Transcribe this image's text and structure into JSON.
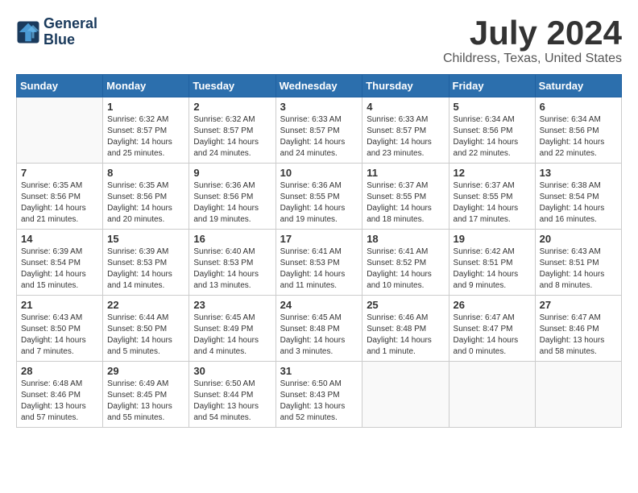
{
  "logo": {
    "line1": "General",
    "line2": "Blue"
  },
  "title": "July 2024",
  "location": "Childress, Texas, United States",
  "weekdays": [
    "Sunday",
    "Monday",
    "Tuesday",
    "Wednesday",
    "Thursday",
    "Friday",
    "Saturday"
  ],
  "weeks": [
    [
      {
        "day": "",
        "sunrise": "",
        "sunset": "",
        "daylight": ""
      },
      {
        "day": "1",
        "sunrise": "Sunrise: 6:32 AM",
        "sunset": "Sunset: 8:57 PM",
        "daylight": "Daylight: 14 hours and 25 minutes."
      },
      {
        "day": "2",
        "sunrise": "Sunrise: 6:32 AM",
        "sunset": "Sunset: 8:57 PM",
        "daylight": "Daylight: 14 hours and 24 minutes."
      },
      {
        "day": "3",
        "sunrise": "Sunrise: 6:33 AM",
        "sunset": "Sunset: 8:57 PM",
        "daylight": "Daylight: 14 hours and 24 minutes."
      },
      {
        "day": "4",
        "sunrise": "Sunrise: 6:33 AM",
        "sunset": "Sunset: 8:57 PM",
        "daylight": "Daylight: 14 hours and 23 minutes."
      },
      {
        "day": "5",
        "sunrise": "Sunrise: 6:34 AM",
        "sunset": "Sunset: 8:56 PM",
        "daylight": "Daylight: 14 hours and 22 minutes."
      },
      {
        "day": "6",
        "sunrise": "Sunrise: 6:34 AM",
        "sunset": "Sunset: 8:56 PM",
        "daylight": "Daylight: 14 hours and 22 minutes."
      }
    ],
    [
      {
        "day": "7",
        "sunrise": "Sunrise: 6:35 AM",
        "sunset": "Sunset: 8:56 PM",
        "daylight": "Daylight: 14 hours and 21 minutes."
      },
      {
        "day": "8",
        "sunrise": "Sunrise: 6:35 AM",
        "sunset": "Sunset: 8:56 PM",
        "daylight": "Daylight: 14 hours and 20 minutes."
      },
      {
        "day": "9",
        "sunrise": "Sunrise: 6:36 AM",
        "sunset": "Sunset: 8:56 PM",
        "daylight": "Daylight: 14 hours and 19 minutes."
      },
      {
        "day": "10",
        "sunrise": "Sunrise: 6:36 AM",
        "sunset": "Sunset: 8:55 PM",
        "daylight": "Daylight: 14 hours and 19 minutes."
      },
      {
        "day": "11",
        "sunrise": "Sunrise: 6:37 AM",
        "sunset": "Sunset: 8:55 PM",
        "daylight": "Daylight: 14 hours and 18 minutes."
      },
      {
        "day": "12",
        "sunrise": "Sunrise: 6:37 AM",
        "sunset": "Sunset: 8:55 PM",
        "daylight": "Daylight: 14 hours and 17 minutes."
      },
      {
        "day": "13",
        "sunrise": "Sunrise: 6:38 AM",
        "sunset": "Sunset: 8:54 PM",
        "daylight": "Daylight: 14 hours and 16 minutes."
      }
    ],
    [
      {
        "day": "14",
        "sunrise": "Sunrise: 6:39 AM",
        "sunset": "Sunset: 8:54 PM",
        "daylight": "Daylight: 14 hours and 15 minutes."
      },
      {
        "day": "15",
        "sunrise": "Sunrise: 6:39 AM",
        "sunset": "Sunset: 8:53 PM",
        "daylight": "Daylight: 14 hours and 14 minutes."
      },
      {
        "day": "16",
        "sunrise": "Sunrise: 6:40 AM",
        "sunset": "Sunset: 8:53 PM",
        "daylight": "Daylight: 14 hours and 13 minutes."
      },
      {
        "day": "17",
        "sunrise": "Sunrise: 6:41 AM",
        "sunset": "Sunset: 8:53 PM",
        "daylight": "Daylight: 14 hours and 11 minutes."
      },
      {
        "day": "18",
        "sunrise": "Sunrise: 6:41 AM",
        "sunset": "Sunset: 8:52 PM",
        "daylight": "Daylight: 14 hours and 10 minutes."
      },
      {
        "day": "19",
        "sunrise": "Sunrise: 6:42 AM",
        "sunset": "Sunset: 8:51 PM",
        "daylight": "Daylight: 14 hours and 9 minutes."
      },
      {
        "day": "20",
        "sunrise": "Sunrise: 6:43 AM",
        "sunset": "Sunset: 8:51 PM",
        "daylight": "Daylight: 14 hours and 8 minutes."
      }
    ],
    [
      {
        "day": "21",
        "sunrise": "Sunrise: 6:43 AM",
        "sunset": "Sunset: 8:50 PM",
        "daylight": "Daylight: 14 hours and 7 minutes."
      },
      {
        "day": "22",
        "sunrise": "Sunrise: 6:44 AM",
        "sunset": "Sunset: 8:50 PM",
        "daylight": "Daylight: 14 hours and 5 minutes."
      },
      {
        "day": "23",
        "sunrise": "Sunrise: 6:45 AM",
        "sunset": "Sunset: 8:49 PM",
        "daylight": "Daylight: 14 hours and 4 minutes."
      },
      {
        "day": "24",
        "sunrise": "Sunrise: 6:45 AM",
        "sunset": "Sunset: 8:48 PM",
        "daylight": "Daylight: 14 hours and 3 minutes."
      },
      {
        "day": "25",
        "sunrise": "Sunrise: 6:46 AM",
        "sunset": "Sunset: 8:48 PM",
        "daylight": "Daylight: 14 hours and 1 minute."
      },
      {
        "day": "26",
        "sunrise": "Sunrise: 6:47 AM",
        "sunset": "Sunset: 8:47 PM",
        "daylight": "Daylight: 14 hours and 0 minutes."
      },
      {
        "day": "27",
        "sunrise": "Sunrise: 6:47 AM",
        "sunset": "Sunset: 8:46 PM",
        "daylight": "Daylight: 13 hours and 58 minutes."
      }
    ],
    [
      {
        "day": "28",
        "sunrise": "Sunrise: 6:48 AM",
        "sunset": "Sunset: 8:46 PM",
        "daylight": "Daylight: 13 hours and 57 minutes."
      },
      {
        "day": "29",
        "sunrise": "Sunrise: 6:49 AM",
        "sunset": "Sunset: 8:45 PM",
        "daylight": "Daylight: 13 hours and 55 minutes."
      },
      {
        "day": "30",
        "sunrise": "Sunrise: 6:50 AM",
        "sunset": "Sunset: 8:44 PM",
        "daylight": "Daylight: 13 hours and 54 minutes."
      },
      {
        "day": "31",
        "sunrise": "Sunrise: 6:50 AM",
        "sunset": "Sunset: 8:43 PM",
        "daylight": "Daylight: 13 hours and 52 minutes."
      },
      {
        "day": "",
        "sunrise": "",
        "sunset": "",
        "daylight": ""
      },
      {
        "day": "",
        "sunrise": "",
        "sunset": "",
        "daylight": ""
      },
      {
        "day": "",
        "sunrise": "",
        "sunset": "",
        "daylight": ""
      }
    ]
  ]
}
